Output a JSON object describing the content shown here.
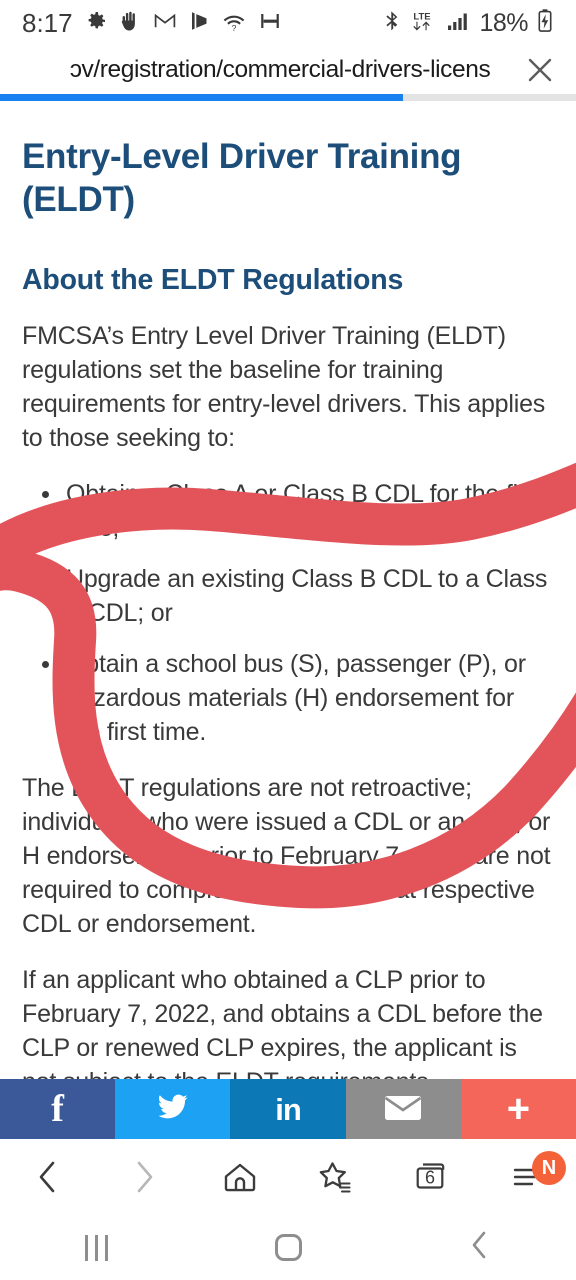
{
  "status_bar": {
    "time": "8:17",
    "battery_percent": "18%",
    "network_type": "LTE",
    "left_icons": [
      "gear-icon",
      "hand-icon",
      "gmail-icon",
      "play-store-icon",
      "wifi-question-icon",
      "screen-capture-icon"
    ],
    "right_icons": [
      "bluetooth-icon",
      "lte-data-icon",
      "signal-bars-icon",
      "battery-charging-icon"
    ]
  },
  "browser": {
    "url_text": "ɔv/registration/commercial-drivers-licens",
    "close_label": "✕",
    "progress_percent": 70,
    "progress_color": "#1a82f0"
  },
  "page": {
    "title": "Entry-Level Driver Training (ELDT)",
    "heading_color": "#1d4e79",
    "section_heading": "About the ELDT Regulations",
    "intro_paragraph": "FMCSA’s Entry Level Driver Training (ELDT) regulations set the baseline for training requirements for entry-level drivers. This applies to those seeking to:",
    "bullets": [
      "Obtain a Class A or Class B CDL for the first time;",
      "Upgrade an existing Class B CDL to a Class A CDL; or",
      "Obtain a school bus (S), passenger (P), or hazardous materials (H) endorsement for the first time."
    ],
    "paragraph_two": "The ELDT regulations are not retroactive; individuals who were issued a CDL or an S, P, or H endorsement prior to February 7, 2022 are not required to complete training for that respective CDL or endorsement.",
    "paragraph_three": "If an applicant who obtained a CLP prior to February 7, 2022, and obtains a CDL before the CLP or renewed CLP expires, the applicant is not subject to the ELDT requirements."
  },
  "annotation": {
    "type": "hand-drawn-red-circle",
    "color": "#e3545a"
  },
  "share_bar": {
    "buttons": [
      {
        "name": "facebook",
        "glyph": "f",
        "color": "#3b5998"
      },
      {
        "name": "twitter",
        "glyph": "",
        "color": "#1da1f2"
      },
      {
        "name": "linkedin",
        "glyph": "in",
        "color": "#0d78b6"
      },
      {
        "name": "email",
        "glyph": "",
        "color": "#8d8d8d"
      },
      {
        "name": "more",
        "glyph": "+",
        "color": "#f4655a"
      }
    ]
  },
  "browser_nav": {
    "back_label": "Back",
    "forward_label": "Forward",
    "home_label": "Home",
    "bookmarks_label": "Bookmarks",
    "tabs_count": "6",
    "menu_badge": "N",
    "menu_badge_color": "#f4623a"
  },
  "android_nav": {
    "recents_label": "Recents",
    "home_label": "Home",
    "back_label": "Back"
  }
}
